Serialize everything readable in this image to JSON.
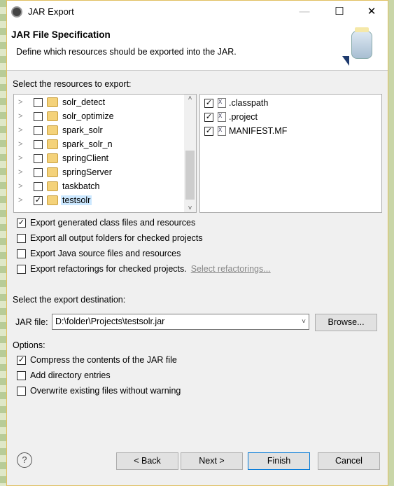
{
  "window": {
    "title": "JAR Export",
    "minimize": "—",
    "maximize": "☐",
    "close": "✕"
  },
  "header": {
    "title": "JAR File Specification",
    "description": "Define which resources should be exported into the JAR."
  },
  "resources": {
    "label": "Select the resources to export:",
    "projects": [
      {
        "name": "solr_detect",
        "checked": false,
        "selected": false
      },
      {
        "name": "solr_optimize",
        "checked": false,
        "selected": false
      },
      {
        "name": "spark_solr",
        "checked": false,
        "selected": false
      },
      {
        "name": "spark_solr_n",
        "checked": false,
        "selected": false
      },
      {
        "name": "springClient",
        "checked": false,
        "selected": false
      },
      {
        "name": "springServer",
        "checked": false,
        "selected": false
      },
      {
        "name": "taskbatch",
        "checked": false,
        "selected": false
      },
      {
        "name": "testsolr",
        "checked": true,
        "selected": true
      }
    ],
    "files": [
      {
        "name": ".classpath",
        "checked": true
      },
      {
        "name": ".project",
        "checked": true
      },
      {
        "name": "MANIFEST.MF",
        "checked": true
      }
    ]
  },
  "options_export": [
    {
      "label": "Export generated class files and resources",
      "checked": true
    },
    {
      "label": "Export all output folders for checked projects",
      "checked": false
    },
    {
      "label": "Export Java source files and resources",
      "checked": false
    },
    {
      "label": "Export refactorings for checked projects.",
      "checked": false
    }
  ],
  "select_refactorings": "Select refactorings...",
  "destination": {
    "label": "Select the export destination:",
    "jar_label": "JAR file:",
    "jar_value": "D:\\folder\\Projects\\testsolr.jar",
    "browse": "Browse..."
  },
  "options": {
    "label": "Options:",
    "items": [
      {
        "label": "Compress the contents of the JAR file",
        "checked": true
      },
      {
        "label": "Add directory entries",
        "checked": false
      },
      {
        "label": "Overwrite existing files without warning",
        "checked": false
      }
    ]
  },
  "buttons": {
    "help": "?",
    "back": "< Back",
    "next": "Next >",
    "finish": "Finish",
    "cancel": "Cancel"
  }
}
